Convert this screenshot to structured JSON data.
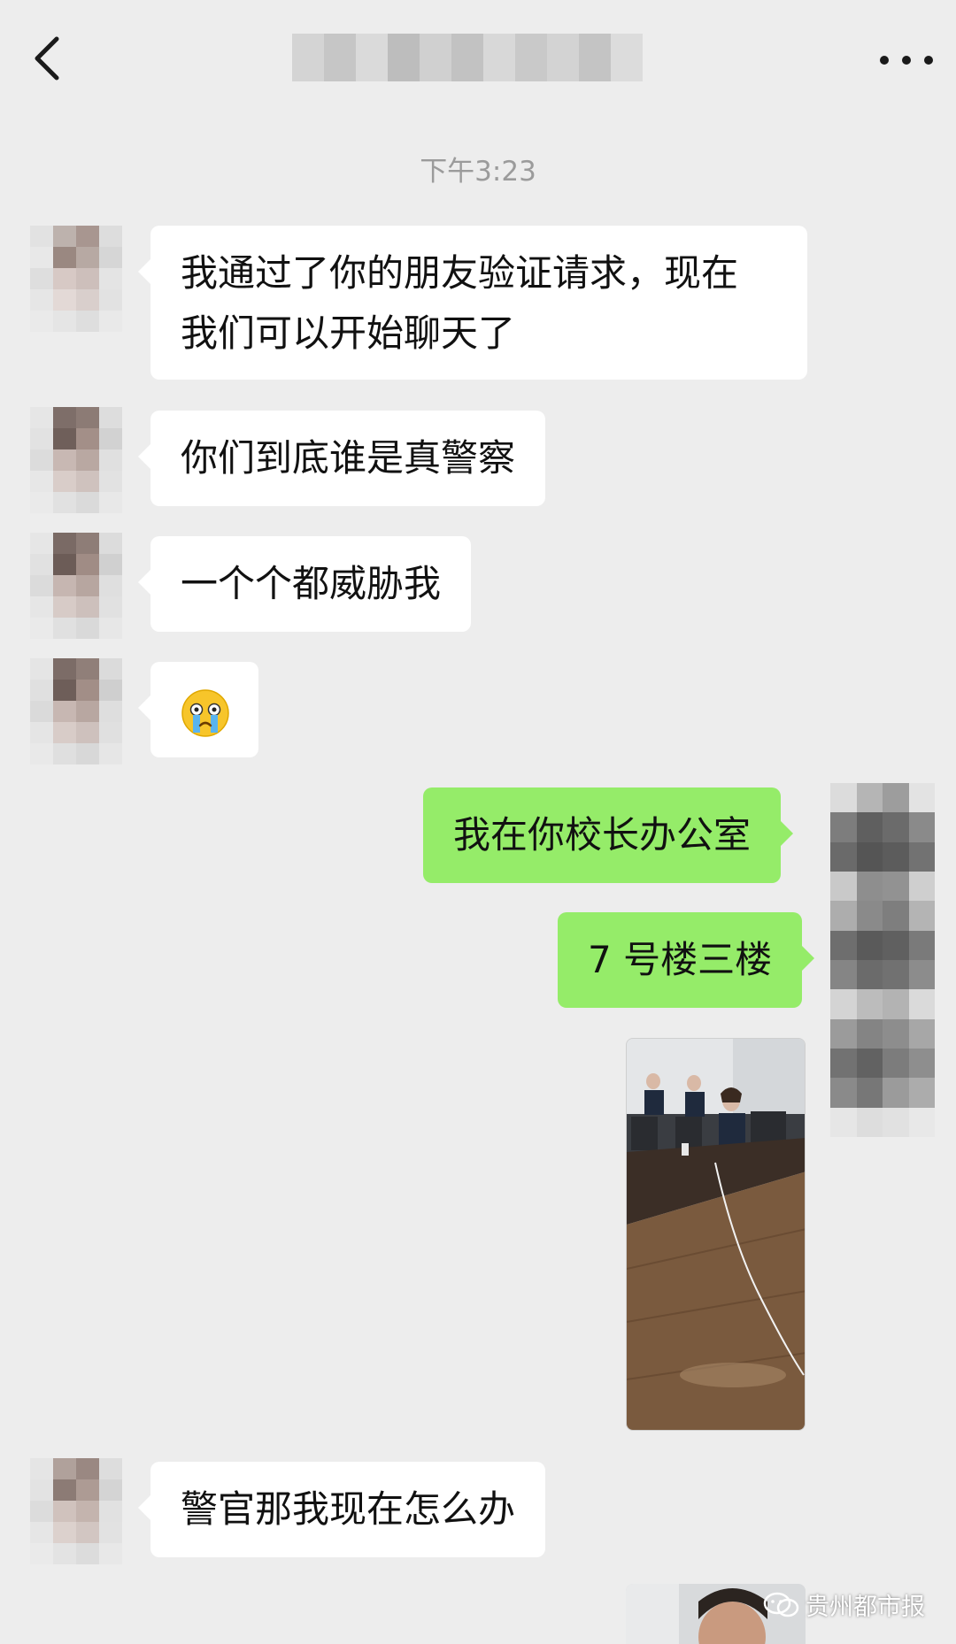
{
  "header": {
    "title": "",
    "back_icon": "chevron-left-icon",
    "more_icon": "ellipsis-icon"
  },
  "timestamp": "下午3:23",
  "messages": [
    {
      "side": "left",
      "lines": [
        "我通过了你的朋友验证请求，现在",
        "我们可以开始聊天了"
      ]
    },
    {
      "side": "left",
      "text": "你们到底谁是真警察"
    },
    {
      "side": "left",
      "text": "一个个都威胁我"
    },
    {
      "side": "left",
      "emoji": "crying-face-emoji"
    },
    {
      "side": "right",
      "text": "我在你校长办公室"
    },
    {
      "side": "right",
      "text": "7 号楼三楼"
    },
    {
      "side": "right",
      "image": "office-photo"
    },
    {
      "side": "left",
      "text": "警官那我现在怎么办"
    },
    {
      "side": "right",
      "image": "photo-partial"
    }
  ],
  "watermark": {
    "text": "贵州都市报",
    "icon": "wechat-official-account-icon"
  },
  "colors": {
    "background": "#ededed",
    "incoming": "#ffffff",
    "outgoing": "#95ec69",
    "timestamp": "#9b9b9b"
  }
}
